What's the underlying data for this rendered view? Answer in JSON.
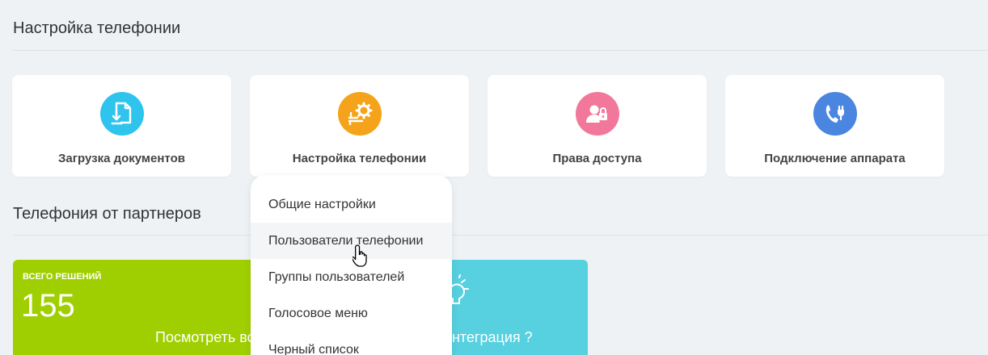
{
  "sections": {
    "telephony_settings_title": "Настройка телефонии",
    "partners_title": "Телефония от партнеров"
  },
  "tiles": [
    {
      "label": "Загрузка документов",
      "icon": "document-download-icon",
      "color": "#2fc4ee"
    },
    {
      "label": "Настройка телефонии",
      "icon": "telephony-settings-icon",
      "color": "#f5a31a"
    },
    {
      "label": "Права доступа",
      "icon": "user-lock-icon",
      "color": "#f2789b"
    },
    {
      "label": "Подключение аппарата",
      "icon": "phone-plug-icon",
      "color": "#4a86e0"
    }
  ],
  "dropdown": {
    "items": [
      {
        "label": "Общие настройки"
      },
      {
        "label": "Пользователи телефонии",
        "hovered": true
      },
      {
        "label": "Группы пользователей"
      },
      {
        "label": "Голосовое меню"
      },
      {
        "label": "Черный список"
      }
    ]
  },
  "partners": {
    "total_label": "ВСЕГО РЕШЕНИЙ",
    "total_value": "155",
    "view_all_link": "Посмотреть все",
    "integration_link": "Интеграция ?",
    "green_color": "#9fcf00",
    "blue_color": "#57d0e0"
  }
}
